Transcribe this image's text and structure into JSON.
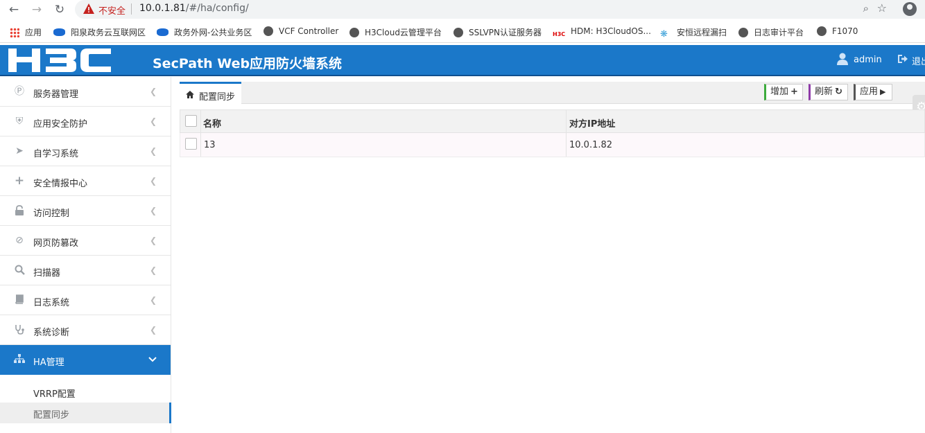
{
  "browser": {
    "security_label": "不安全",
    "url_host": "10.0.1.81",
    "url_path": "/#/ha/config/",
    "bookmarks": [
      {
        "label": "应用",
        "icon": "apps-grid-icon"
      },
      {
        "label": "阳泉政务云互联网区",
        "icon": "cloud-icon"
      },
      {
        "label": "政务外网-公共业务区",
        "icon": "cloud-icon"
      },
      {
        "label": "VCF Controller",
        "icon": "globe-icon"
      },
      {
        "label": "H3Cloud云管理平台",
        "icon": "globe-icon"
      },
      {
        "label": "SSLVPN认证服务器",
        "icon": "globe-icon"
      },
      {
        "label": "HDM: H3CloudOS...",
        "icon": "h3c-icon"
      },
      {
        "label": "安恒远程漏扫",
        "icon": "fan-icon"
      },
      {
        "label": "日志审计平台",
        "icon": "globe-icon"
      },
      {
        "label": "F1070",
        "icon": "globe-icon"
      }
    ]
  },
  "header": {
    "title": "SecPath Web应用防火墙系统",
    "user": "admin",
    "logout": "退出"
  },
  "sidebar": {
    "items": [
      {
        "label": "服务器管理",
        "icon": "server-icon"
      },
      {
        "label": "应用安全防护",
        "icon": "shield-icon"
      },
      {
        "label": "自学习系统",
        "icon": "rocket-icon"
      },
      {
        "label": "安全情报中心",
        "icon": "plus-icon"
      },
      {
        "label": "访问控制",
        "icon": "lock-icon"
      },
      {
        "label": "网页防篡改",
        "icon": "ban-icon"
      },
      {
        "label": "扫描器",
        "icon": "search-icon"
      },
      {
        "label": "日志系统",
        "icon": "book-icon"
      },
      {
        "label": "系统诊断",
        "icon": "stethoscope-icon"
      },
      {
        "label": "HA管理",
        "icon": "sitemap-icon"
      }
    ],
    "sub_items": [
      {
        "label": "VRRP配置"
      },
      {
        "label": "配置同步"
      }
    ]
  },
  "main": {
    "tab_label": "配置同步",
    "buttons": {
      "add": "增加",
      "refresh": "刷新",
      "apply": "应用"
    },
    "table": {
      "columns": [
        "名称",
        "对方IP地址"
      ],
      "rows": [
        {
          "name": "13",
          "peer_ip": "10.0.1.82"
        }
      ]
    }
  },
  "colors": {
    "header_blue": "#1b78c9",
    "add_accent": "#3cab3c",
    "refresh_accent": "#8e3aa8"
  }
}
